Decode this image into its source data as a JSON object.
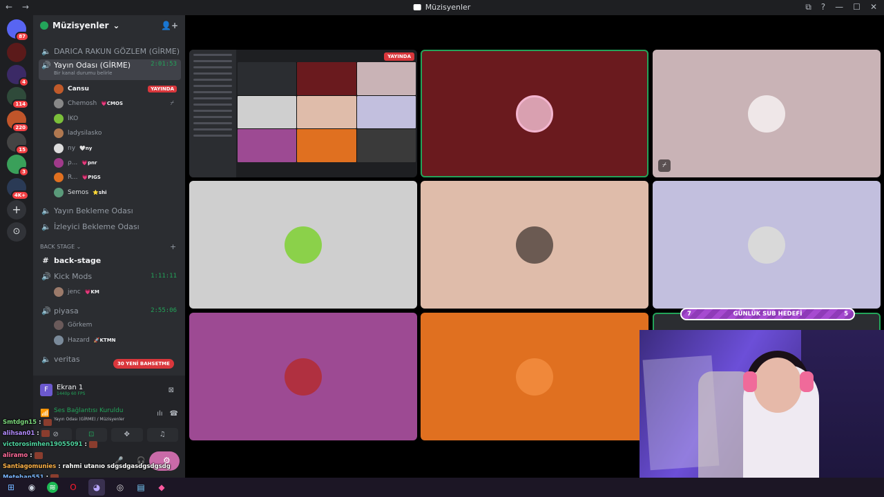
{
  "window": {
    "title": "Müzisyenler",
    "back": "←",
    "forward": "→",
    "controls": [
      "⧉",
      "?",
      "—",
      "☐",
      "✕"
    ]
  },
  "servers": [
    {
      "name": "home",
      "badge": "87",
      "color": "#5865f2"
    },
    {
      "name": "server-1",
      "badge": "",
      "color": "#5b1a1a"
    },
    {
      "name": "server-2",
      "badge": "4",
      "color": "#3b2a66"
    },
    {
      "name": "server-3",
      "badge": "114",
      "color": "#2f4a3a"
    },
    {
      "name": "server-4",
      "badge": "220",
      "color": "#c0552a"
    },
    {
      "name": "server-5",
      "badge": "15",
      "color": "#444"
    },
    {
      "name": "server-6",
      "badge": "3",
      "color": "#3aa05a"
    },
    {
      "name": "server-7",
      "badge": "4K+",
      "color": "#2a3a55"
    }
  ],
  "sidebar": {
    "server_name": "Müzisyenler",
    "invite_icon": "add-user",
    "channels": {
      "darica": "DARICA RAKUN GÖZLEM (GİRME)",
      "yayin_odasi": "Yayın Odası (GİRME)",
      "yayin_odasi_status": "Bir kanal durumu belirle",
      "yayin_odasi_timer": "2:01:53",
      "yayin_bekleme": "Yayın Bekleme Odası",
      "izleyici_bekleme": "İzleyici Bekleme Odası",
      "back_stage_cat": "BACK STAGE",
      "back_stage": "back-stage",
      "kick_mods": "Kick Mods",
      "kick_mods_timer": "1:11:11",
      "piyasa": "piyasa",
      "piyasa_timer": "2:55:06",
      "veritas": "veritas"
    },
    "users": [
      {
        "name": "Cansu",
        "tag": "",
        "live": "YAYINDA",
        "color": "#c05a2a"
      },
      {
        "name": "Chemosh",
        "tag": "💗CMOS",
        "live": "",
        "color": "#888"
      },
      {
        "name": "İKO",
        "tag": "",
        "live": "",
        "color": "#7bbf3a"
      },
      {
        "name": "ladysilasko",
        "tag": "",
        "live": "",
        "color": "#b07850"
      },
      {
        "name": "ny",
        "tag": "🤍ny",
        "live": "",
        "color": "#ddd"
      },
      {
        "name": "ρ...",
        "tag": "💗pnr",
        "live": "",
        "color": "#a03a8a"
      },
      {
        "name": "R...",
        "tag": "💗PIGS",
        "live": "",
        "color": "#e07020"
      },
      {
        "name": "Semos",
        "tag": "⭐shi",
        "live": "",
        "color": "#5a9a7a"
      }
    ],
    "kick_users": [
      {
        "name": "jenc",
        "tag": "💗KM"
      }
    ],
    "piyasa_users": [
      {
        "name": "Görkem",
        "tag": ""
      },
      {
        "name": "Hazard",
        "tag": "🚀KTMN"
      }
    ],
    "new_messages": "30 YENİ BAHSETME"
  },
  "panel": {
    "screen_title": "Ekran 1",
    "screen_sub": "1440p 60 FPS",
    "voice_title": "Ses Bağlantısı Kuruldu",
    "voice_sub": "Yayın Odası (GİRME) / Müzisyenler"
  },
  "chat": [
    {
      "user": "Smtdgn15",
      "color": "#7cd97c",
      "text": ":"
    },
    {
      "user": "alihsan01",
      "color": "#b48cff",
      "text": ":"
    },
    {
      "user": "victorosimhen19055091",
      "color": "#4fd6a0",
      "text": ":"
    },
    {
      "user": "aliramo",
      "color": "#ff6b9a",
      "text": ":"
    },
    {
      "user": "Santiagomunies",
      "color": "#ffb347",
      "text": ": rahmi utanıo sdgsdgasdgsdgsdg"
    },
    {
      "user": "Metehan551",
      "color": "#7ab8ff",
      "text": ":"
    }
  ],
  "stage": {
    "live_badge": "YAYINDA",
    "tiles": [
      {
        "name": "screenshare",
        "color": "#1e1f22"
      },
      {
        "name": "tile-2",
        "color": "#6a1a1e",
        "avatar": "#d9a0b0"
      },
      {
        "name": "tile-3",
        "color": "#c9b3b6",
        "avatar": "#efe7e8"
      },
      {
        "name": "tile-4",
        "color": "#cfcfcf",
        "avatar": "#8bd14a"
      },
      {
        "name": "tile-5",
        "color": "#dfbcaa",
        "avatar": "#6b5a52"
      },
      {
        "name": "tile-6",
        "color": "#c2bfde",
        "avatar": "#d9d9d9"
      },
      {
        "name": "tile-7",
        "color": "#9d4a93",
        "avatar": "#b03040"
      },
      {
        "name": "tile-8",
        "color": "#e07020",
        "avatar": "#f0883a"
      }
    ]
  },
  "overlay": {
    "goal_left": "7",
    "goal_label": "GÜNLÜK SUB HEDEFİ",
    "goal_right": "5"
  },
  "taskbar": [
    "windows",
    "steam",
    "spotify",
    "opera",
    "discord",
    "obs",
    "files",
    "app"
  ]
}
